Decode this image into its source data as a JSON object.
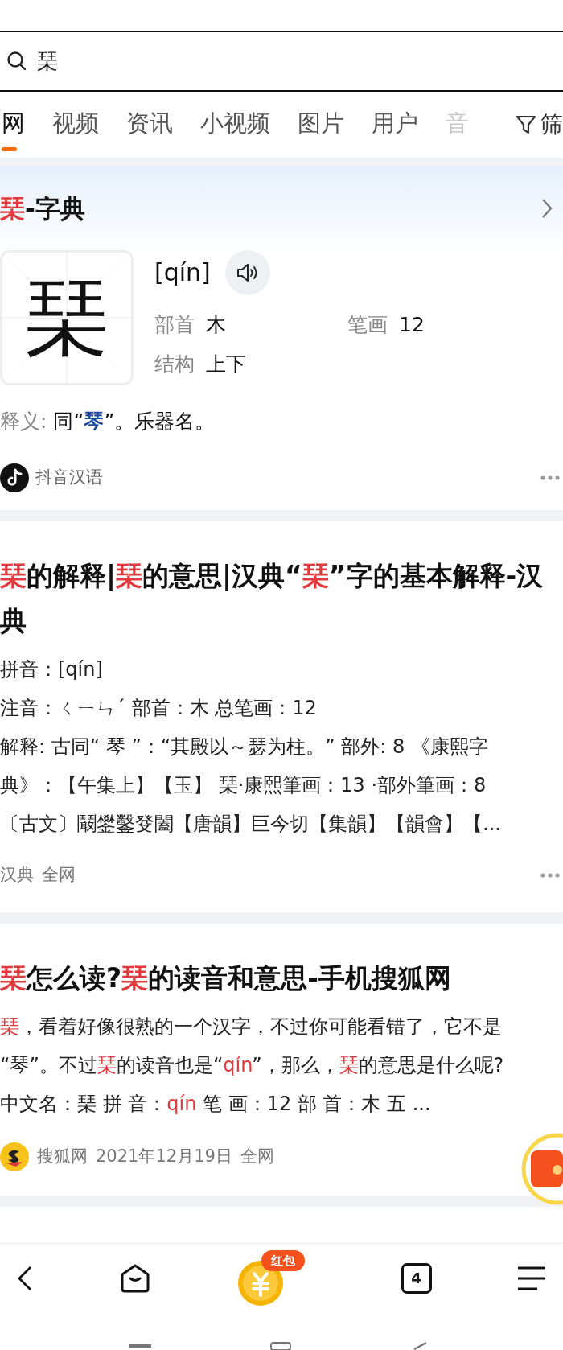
{
  "search": {
    "value": "琹"
  },
  "tabs": [
    {
      "label": "网",
      "selected": true
    },
    {
      "label": "视频",
      "selected": false
    },
    {
      "label": "资讯",
      "selected": false
    },
    {
      "label": "小视频",
      "selected": false
    },
    {
      "label": "图片",
      "selected": false
    },
    {
      "label": "用户",
      "selected": false
    },
    {
      "label": "音",
      "selected": false
    }
  ],
  "filter": {
    "label": "筛"
  },
  "dict_card": {
    "title": [
      {
        "text": "琹",
        "highlight": true
      },
      {
        "text": "-字典",
        "highlight": false
      }
    ],
    "character": "琹",
    "pinyin": "[qín]",
    "fields": [
      {
        "label": "部首",
        "value": "木"
      },
      {
        "label": "笔画",
        "value": "12"
      },
      {
        "label": "结构",
        "value": "上下"
      }
    ],
    "meaning_label": "释义:",
    "meaning": [
      {
        "text": "同“",
        "link": false
      },
      {
        "text": "琴",
        "link": true
      },
      {
        "text": "”。乐器名。",
        "link": false
      }
    ],
    "source": "抖音汉语"
  },
  "results": [
    {
      "title": [
        {
          "text": "琹",
          "highlight": true
        },
        {
          "text": "的解释|",
          "highlight": false
        },
        {
          "text": "琹",
          "highlight": true
        },
        {
          "text": "的意思|汉典“",
          "highlight": false
        },
        {
          "text": "琹",
          "highlight": true
        },
        {
          "text": "”字的基本解释-汉典",
          "highlight": false
        }
      ],
      "lines": [
        [
          {
            "text": "拼音：[qín]",
            "highlight": false
          }
        ],
        [
          {
            "text": "注音：ㄑㄧㄣˊ 部首：木  总笔画：12",
            "highlight": false
          }
        ],
        [
          {
            "text": "解释: 古同“ 琴 ”：“其殿以～瑟为柱。” 部外: 8 《康熙字",
            "highlight": false
          }
        ],
        [
          {
            "text": "典》：【午集上】【玉】 琹·康熙筆画：13 ·部外筆画：8",
            "highlight": false
          }
        ],
        [
          {
            "text": "〔古文〕鬫鐢鑿癹闔【唐韻】巨今切【集韻】【韻會】【...",
            "highlight": false
          }
        ]
      ],
      "source_logo": false,
      "source": "汉典",
      "scope": "全网"
    },
    {
      "title": [
        {
          "text": "琹",
          "highlight": true
        },
        {
          "text": "怎么读?",
          "highlight": false
        },
        {
          "text": "琹",
          "highlight": true
        },
        {
          "text": "的读音和意思-手机搜狐网",
          "highlight": false
        }
      ],
      "lines": [
        [
          {
            "text": "琹",
            "highlight": true
          },
          {
            "text": "，看着好像很熟的一个汉字，不过你可能看错了，它不是",
            "highlight": false
          }
        ],
        [
          {
            "text": "“琴”。不过",
            "highlight": false
          },
          {
            "text": "琹",
            "highlight": true
          },
          {
            "text": "的读音也是“",
            "highlight": false
          },
          {
            "text": "qín",
            "highlight": true
          },
          {
            "text": "”，那么，",
            "highlight": false
          },
          {
            "text": "琹",
            "highlight": true
          },
          {
            "text": "的意思是什么呢?",
            "highlight": false
          }
        ],
        [
          {
            "text": "中文名：琹 拼 音：",
            "highlight": false
          },
          {
            "text": "qín",
            "highlight": true
          },
          {
            "text": " 笔 画：12 部 首：木 五 ...",
            "highlight": false
          }
        ]
      ],
      "source_logo": true,
      "source": "搜狐网",
      "date": "2021年12月19日",
      "scope": "全网"
    }
  ],
  "bottom_nav": {
    "badge": "红包",
    "tab_count": "4"
  }
}
